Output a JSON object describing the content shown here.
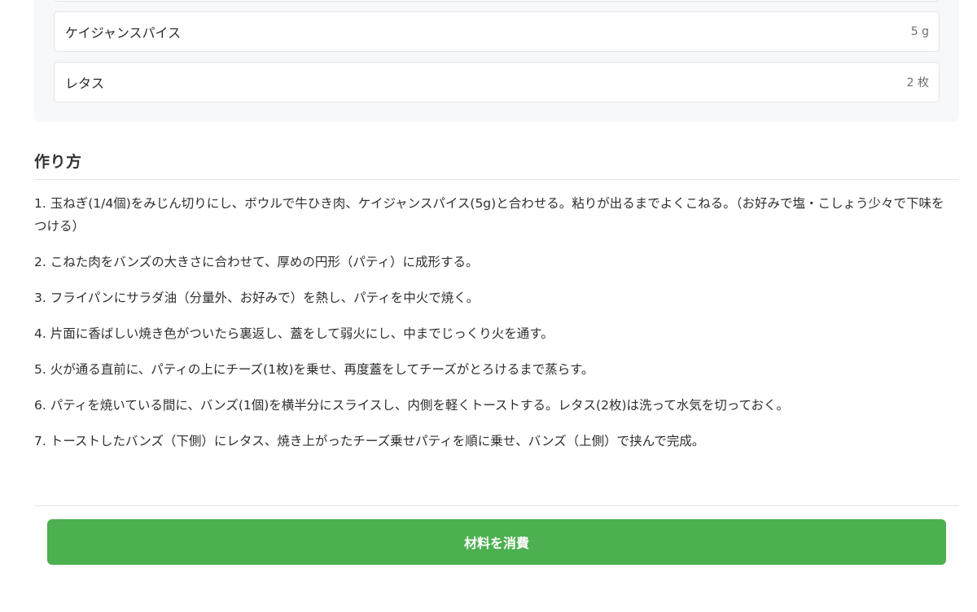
{
  "ingredients": {
    "items": [
      {
        "name": "ケイジャンスパイス",
        "quantity": "5 g"
      },
      {
        "name": "レタス",
        "quantity": "2 枚"
      }
    ]
  },
  "instructions": {
    "title": "作り方",
    "steps": [
      "1. 玉ねぎ(1/4個)をみじん切りにし、ボウルで牛ひき肉、ケイジャンスパイス(5g)と合わせる。粘りが出るまでよくこねる。（お好みで塩・こしょう少々で下味をつける）",
      "2. こねた肉をバンズの大きさに合わせて、厚めの円形（パティ）に成形する。",
      "3. フライパンにサラダ油（分量外、お好みで）を熱し、パティを中火で焼く。",
      "4. 片面に香ばしい焼き色がついたら裏返し、蓋をして弱火にし、中までじっくり火を通す。",
      "5. 火が通る直前に、パティの上にチーズ(1枚)を乗せ、再度蓋をしてチーズがとろけるまで蒸らす。",
      "6. パティを焼いている間に、バンズ(1個)を横半分にスライスし、内側を軽くトーストする。レタス(2枚)は洗って水気を切っておく。",
      "7. トーストしたバンズ（下側）にレタス、焼き上がったチーズ乗せパティを順に乗せ、バンズ（上側）で挟んで完成。"
    ]
  },
  "actions": {
    "consume_label": "材料を消費",
    "accent_color": "#4caf50"
  }
}
